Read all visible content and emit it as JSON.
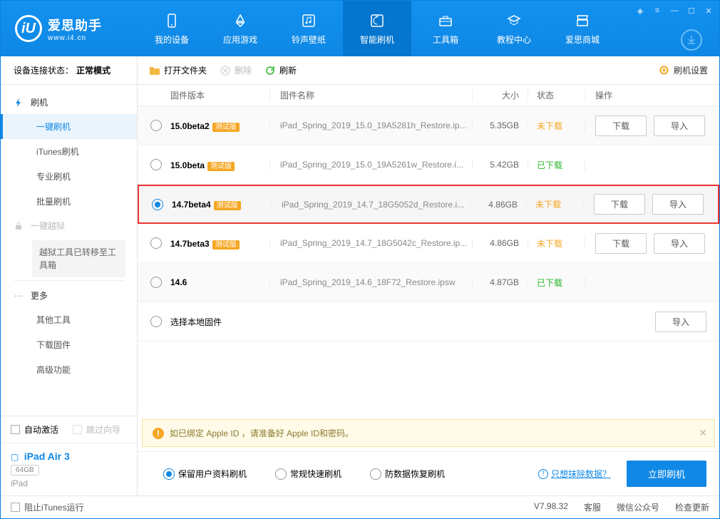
{
  "logo": {
    "main": "爱思助手",
    "sub": "www.i4.cn",
    "glyph": "iU"
  },
  "nav": [
    {
      "label": "我的设备",
      "icon": "phone-icon"
    },
    {
      "label": "应用游戏",
      "icon": "apps-icon"
    },
    {
      "label": "铃声壁纸",
      "icon": "music-icon"
    },
    {
      "label": "智能刷机",
      "icon": "refresh-icon",
      "active": true
    },
    {
      "label": "工具箱",
      "icon": "toolbox-icon"
    },
    {
      "label": "教程中心",
      "icon": "tutorial-icon"
    },
    {
      "label": "爱思商城",
      "icon": "shop-icon"
    }
  ],
  "conn": {
    "label": "设备连接状态：",
    "value": "正常模式"
  },
  "side": {
    "flash_head": "刷机",
    "items1": [
      "一键刷机",
      "iTunes刷机",
      "专业刷机",
      "批量刷机"
    ],
    "jailbreak": "一键越狱",
    "jb_note": "越狱工具已转移至工具箱",
    "more_head": "更多",
    "items2": [
      "其他工具",
      "下载固件",
      "高级功能"
    ]
  },
  "side_bottom": {
    "auto_activate": "自动激活",
    "skip_guide": "跳过向导",
    "device_name": "iPad Air 3",
    "capacity": "64GB",
    "device_sub": "iPad"
  },
  "toolbar": {
    "open": "打开文件夹",
    "delete": "删除",
    "refresh": "刷新",
    "settings": "刷机设置"
  },
  "cols": {
    "ver": "固件版本",
    "name": "固件名称",
    "size": "大小",
    "status": "状态",
    "ops": "操作"
  },
  "rows": [
    {
      "ver": "15.0beta2",
      "beta": "测试版",
      "name": "iPad_Spring_2019_15.0_19A5281h_Restore.ip...",
      "size": "5.35GB",
      "status": "未下载",
      "status_cls": "no",
      "dl": true,
      "imp": true,
      "sel": false
    },
    {
      "ver": "15.0beta",
      "beta": "测试版",
      "name": "iPad_Spring_2019_15.0_19A5261w_Restore.i...",
      "size": "5.42GB",
      "status": "已下载",
      "status_cls": "yes",
      "dl": false,
      "imp": false,
      "sel": false
    },
    {
      "ver": "14.7beta4",
      "beta": "测试版",
      "name": "iPad_Spring_2019_14.7_18G5052d_Restore.i...",
      "size": "4.86GB",
      "status": "未下载",
      "status_cls": "no",
      "dl": true,
      "imp": true,
      "sel": true,
      "hl": true
    },
    {
      "ver": "14.7beta3",
      "beta": "测试版",
      "name": "iPad_Spring_2019_14.7_18G5042c_Restore.ip...",
      "size": "4.86GB",
      "status": "未下载",
      "status_cls": "no",
      "dl": true,
      "imp": true,
      "sel": false
    },
    {
      "ver": "14.6",
      "beta": "",
      "name": "iPad_Spring_2019_14.6_18F72_Restore.ipsw",
      "size": "4.87GB",
      "status": "已下载",
      "status_cls": "yes",
      "dl": false,
      "imp": false,
      "sel": false
    }
  ],
  "local_row": {
    "label": "选择本地固件",
    "imp": "导入"
  },
  "btn_labels": {
    "download": "下载",
    "import": "导入"
  },
  "warn": "如已绑定 Apple ID ，请准备好 Apple ID和密码。",
  "opts": [
    "保留用户资料刷机",
    "常规快速刷机",
    "防数据恢复刷机"
  ],
  "opt_sel": 0,
  "erase_link": "只想抹除数据？",
  "flash_btn": "立即刷机",
  "footer": {
    "block": "阻止iTunes运行",
    "ver": "V7.98.32",
    "links": [
      "客服",
      "微信公众号",
      "检查更新"
    ]
  }
}
